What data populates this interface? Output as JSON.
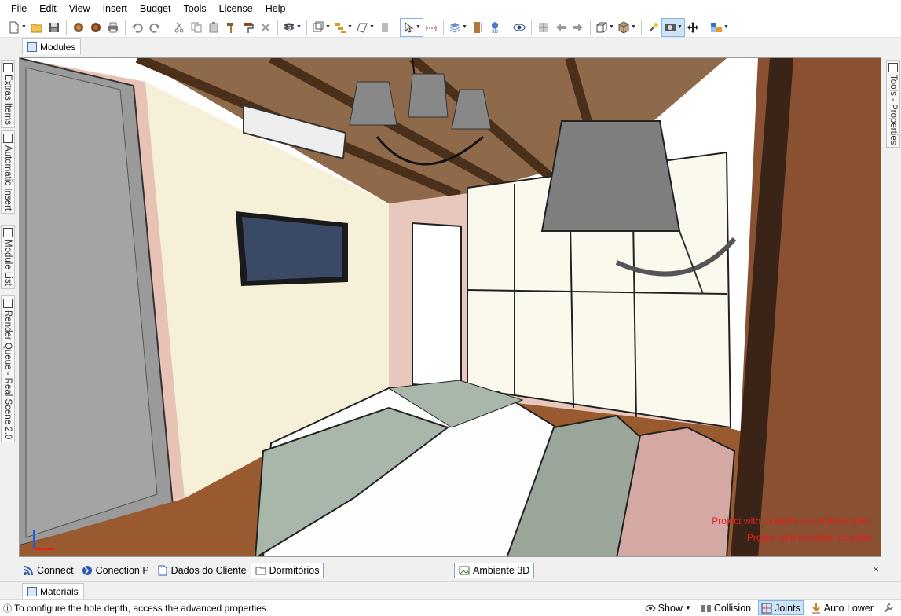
{
  "menu": {
    "items": [
      "File",
      "Edit",
      "View",
      "Insert",
      "Budget",
      "Tools",
      "License",
      "Help"
    ]
  },
  "toolbar": {
    "icons": [
      "new-file-icon",
      "open-folder-icon",
      "save-icon",
      "render-icon",
      "render-alt-icon",
      "print-icon",
      "undo-icon",
      "redo-icon",
      "cut-icon",
      "copy-icon",
      "paste-icon",
      "hammer-icon",
      "paint-roller-icon",
      "delete-icon",
      "money-icon",
      "select-frame-icon",
      "layers-icon",
      "lasso-icon",
      "wall-icon",
      "pointer-icon",
      "measure-icon",
      "3d-layers-icon",
      "3d-view-icon",
      "eye-icon",
      "texture-icon",
      "arrow-left-icon",
      "arrow-right-icon",
      "box-view-icon",
      "cube-icon",
      "light-icon",
      "camera-icon",
      "move-icon",
      "palette-icon"
    ]
  },
  "tabs": {
    "modules": "Modules",
    "materials": "Materials"
  },
  "left_panels": [
    "Extras Items",
    "Automatic Insert",
    "Module List",
    "Render Queue - Real Scene 2.0"
  ],
  "right_panels": [
    "Tools - Properties"
  ],
  "viewport": {
    "warnings": [
      "Project with modules out of limits (the)",
      "Project with lockable modules"
    ]
  },
  "bottom_tabs": {
    "left": [
      {
        "label": "Connect",
        "icon": "rss-icon"
      },
      {
        "label": "Conection P",
        "icon": "globe-icon"
      },
      {
        "label": "Dados do Cliente",
        "icon": "document-icon"
      },
      {
        "label": "Dormitórios",
        "icon": "folder-icon"
      }
    ],
    "center": {
      "label": "Ambiente 3D",
      "icon": "image-icon"
    },
    "close": "×"
  },
  "status": {
    "message": "To configure the hole depth, access the advanced properties.",
    "show": "Show",
    "collision": "Collision",
    "joints": "Joints",
    "auto_lower": "Auto Lower"
  },
  "colors": {
    "selected_bg": "#cde4f7",
    "selected_border": "#7eb4ea",
    "warning_text": "#e02020"
  }
}
